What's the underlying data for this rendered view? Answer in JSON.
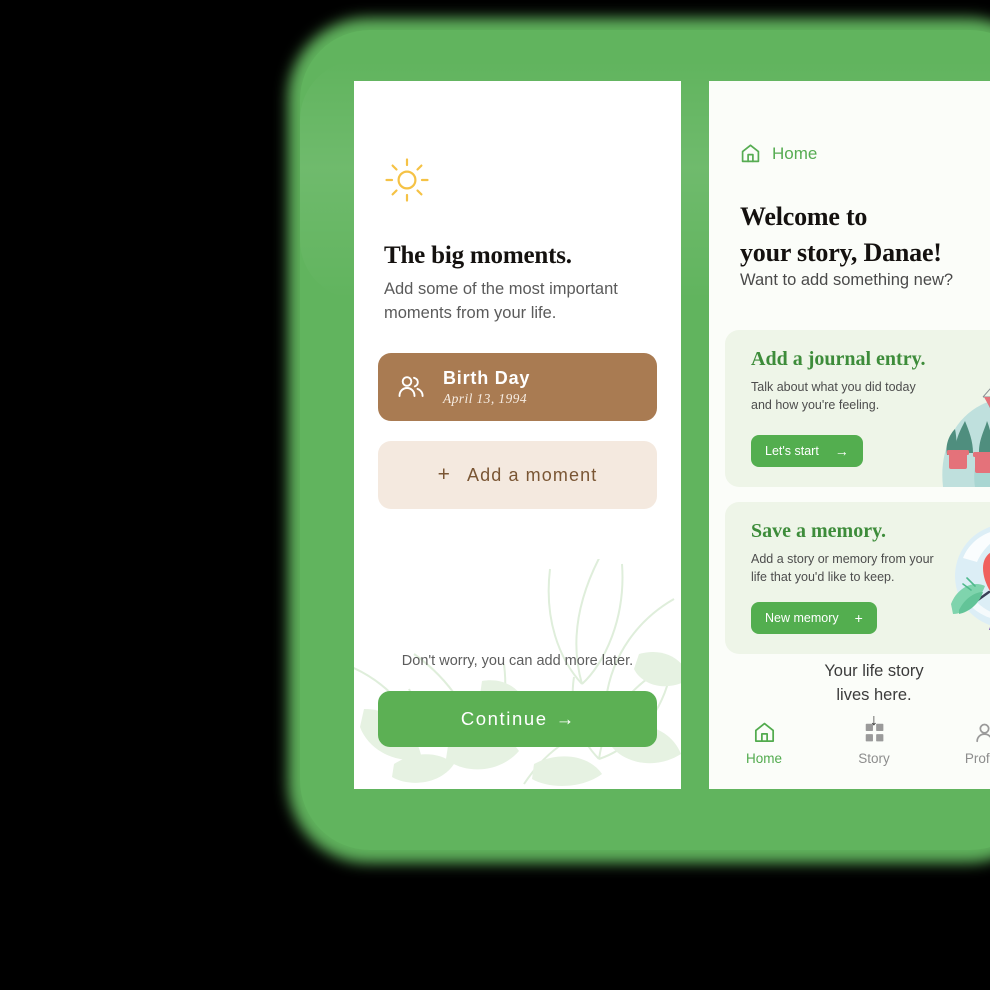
{
  "theme": {
    "brand_green": "#5cb054",
    "backdrop_green": "#61b45e",
    "card_brown": "#a97b52",
    "card_cream": "#f4e9df",
    "promo_bg": "#eef5e8",
    "promo_title_green": "#3d8c3a",
    "sun_yellow": "#f5c245"
  },
  "onboarding_screen": {
    "name": "big-moments",
    "sun_icon": "sun-icon",
    "title": "The big moments.",
    "subtitle": "Add some of the most important moments from your life.",
    "moment_card": {
      "icon": "people-icon",
      "title": "Birth Day",
      "date": "April 13, 1994"
    },
    "add_moment": {
      "plus": "+",
      "label": "Add a moment"
    },
    "hint": "Don't worry, you can add more later.",
    "continue_button": {
      "label": "Continue",
      "arrow": "→"
    }
  },
  "home_screen": {
    "name": "home",
    "breadcrumb": {
      "icon": "home-icon",
      "label": "Home"
    },
    "welcome_title": "Welcome to\nyour story, Danae!",
    "welcome_subtitle": "Want to add something new?",
    "cards": [
      {
        "name": "journal-entry-card",
        "title": "Add a journal entry.",
        "description": "Talk about what you did today and how you're feeling.",
        "button_label": "Let's start",
        "button_icon": "→",
        "illustration": "woman-meditating-with-plants-illustration"
      },
      {
        "name": "save-memory-card",
        "title": "Save a memory.",
        "description": "Add a story or memory from your life that you'd like to keep.",
        "button_label": "New memory",
        "button_icon": "+",
        "illustration": "heart-character-illustration"
      }
    ],
    "life_story_note": {
      "line1": "Your life story",
      "line2": "lives here.",
      "arrow": "↓"
    },
    "tabs": [
      {
        "name": "tab-home",
        "label": "Home",
        "icon": "home-icon",
        "active": true
      },
      {
        "name": "tab-story",
        "label": "Story",
        "icon": "grid-icon",
        "active": false
      },
      {
        "name": "tab-profile",
        "label": "Profile",
        "icon": "person-icon",
        "active": false
      }
    ]
  }
}
